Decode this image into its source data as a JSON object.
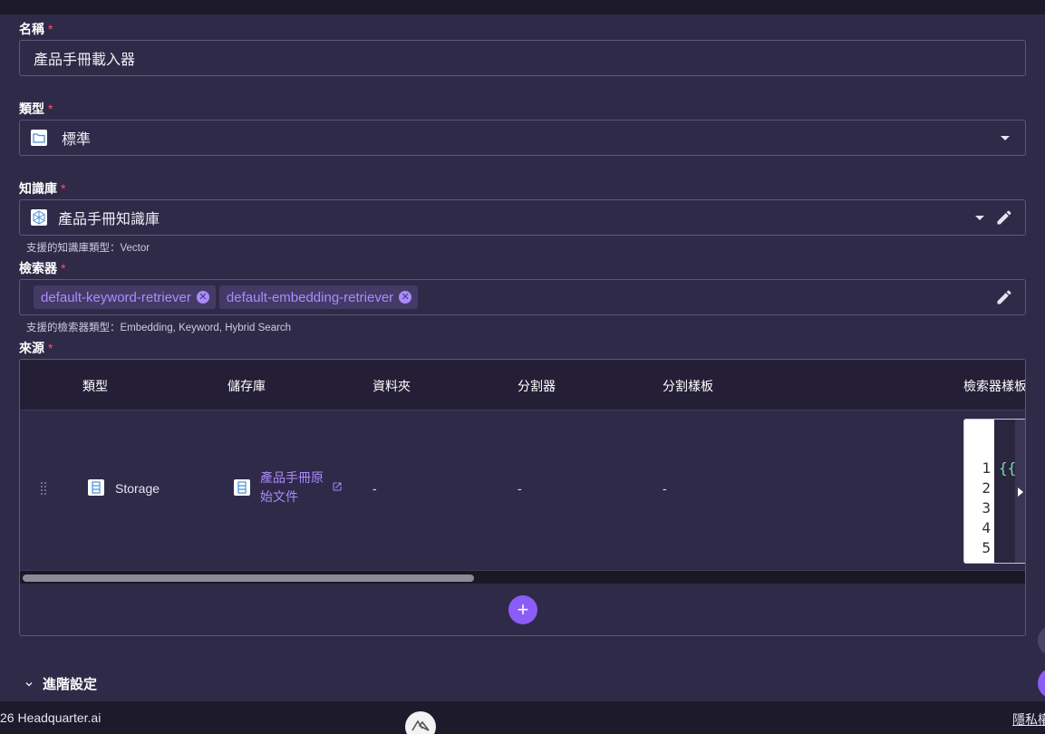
{
  "form": {
    "name": {
      "label": "名稱",
      "required": "*",
      "value": "產品手冊載入器"
    },
    "type": {
      "label": "類型",
      "required": "*",
      "value": "標準",
      "icon": "folder-icon"
    },
    "knowledge_base": {
      "label": "知識庫",
      "required": "*",
      "value": "產品手冊知識庫",
      "hint": "支援的知識庫類型：Vector",
      "icon": "cube-network-icon"
    },
    "retriever": {
      "label": "檢索器",
      "required": "*",
      "chips": [
        "default-keyword-retriever",
        "default-embedding-retriever"
      ],
      "hint": "支援的檢索器類型：Embedding, Keyword, Hybrid Search"
    },
    "source": {
      "label": "來源",
      "required": "*"
    }
  },
  "table": {
    "headers": [
      "類型",
      "儲存庫",
      "資料夾",
      "分割器",
      "分割樣板",
      "檢索器樣板"
    ],
    "rows": [
      {
        "type": "Storage",
        "repository_line1": "產品手冊原",
        "repository_line2": "始文件",
        "folder": "-",
        "splitter": "-",
        "split_template": "-",
        "editor_lines": [
          "1",
          "2",
          "3",
          "4",
          "5"
        ],
        "editor_code": "{{"
      }
    ],
    "add_label": "+"
  },
  "advanced_label": "進階設定",
  "footer": {
    "copyright": "26 Headquarter.ai",
    "privacy_link": "隱私權"
  },
  "colors": {
    "accent": "#8b5cf6",
    "chip_text": "#a98bff",
    "required": "#ff4d6d",
    "panel": "#2f2a47"
  }
}
